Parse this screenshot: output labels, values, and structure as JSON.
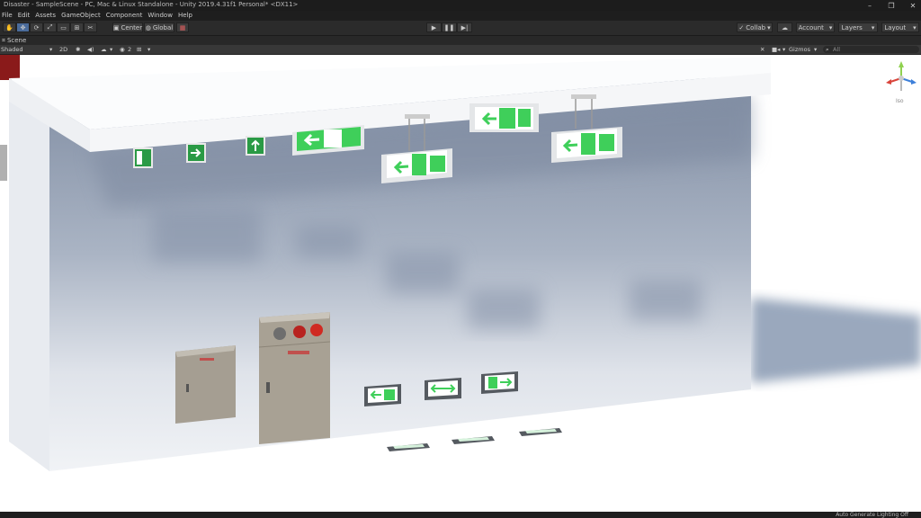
{
  "window": {
    "title": "Disaster - SampleScene - PC, Mac & Linux Standalone - Unity 2019.4.31f1 Personal* <DX11>",
    "controls": [
      "–",
      "❐",
      "✕"
    ]
  },
  "menu": [
    "File",
    "Edit",
    "Assets",
    "GameObject",
    "Component",
    "Window",
    "Help"
  ],
  "toolbar": {
    "tools": [
      "✋",
      "✥",
      "⟳",
      "⤢",
      "▭",
      "⊞",
      "✂"
    ],
    "pivot_label": "Center",
    "space_label": "Global",
    "collab_label": "Collab",
    "account_label": "Account",
    "layers_label": "Layers",
    "layout_label": "Layout"
  },
  "scene_tab": {
    "label": "Scene"
  },
  "scene_bar": {
    "shading_mode": "Shaded",
    "mode_2d": "2D",
    "gizmo_count": "2",
    "gizmos_label": "Gizmos",
    "search_placeholder": "All"
  },
  "orientation_gizmo": {
    "label": "Iso"
  },
  "status": {
    "lighting": "Auto Generate Lighting Off"
  },
  "colors": {
    "sign_green": "#3fcf5a",
    "wall": "#f2f4f7",
    "shadow": "#8e9bb0",
    "toolbar": "#2b2b2b"
  }
}
